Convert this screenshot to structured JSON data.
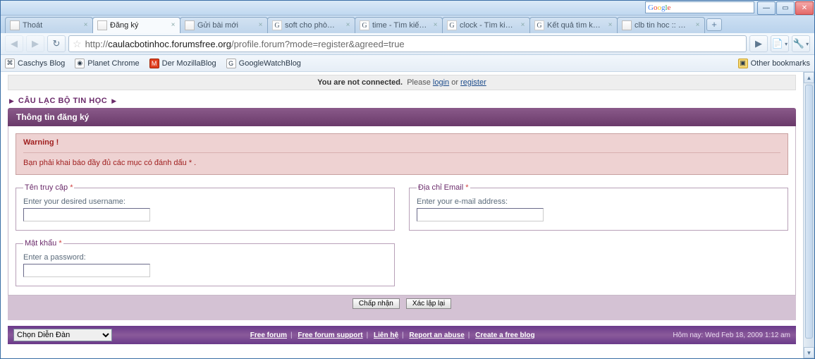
{
  "window": {
    "search_placeholder": "Google"
  },
  "tabs": [
    {
      "label": "Thoát"
    },
    {
      "label": "Đăng ký"
    },
    {
      "label": "Gửi bài mới"
    },
    {
      "label": "soft cho phò…"
    },
    {
      "label": "time - Tìm kiế…"
    },
    {
      "label": "clock - Tìm ki…"
    },
    {
      "label": "Kết quả tìm k…"
    },
    {
      "label": "clb tin hoc :: …"
    }
  ],
  "nav": {
    "url_prefix": "http://",
    "url_domain": "caulacbotinhoc.forumsfree.org",
    "url_path": "/profile.forum?mode=register&agreed=true"
  },
  "bookmarks": [
    {
      "label": "Caschys Blog"
    },
    {
      "label": "Planet Chrome"
    },
    {
      "label": "Der MozillaBlog"
    },
    {
      "label": "GoogleWatchBlog"
    }
  ],
  "other_bookmarks": "Other bookmarks",
  "notice": {
    "bold": "You are not connected.",
    "text1": "Please ",
    "login": "login",
    "or": " or ",
    "register": "register"
  },
  "breadcrumb": {
    "home": "CÂU LẠC BỘ TIN HỌC"
  },
  "section_title": "Thông tin đăng ký",
  "warning": {
    "title": "Warning !",
    "message": "Bạn phải khai báo đầy đủ các mục có đánh dấu * ."
  },
  "fields": {
    "username": {
      "legend": "Tên truy cập",
      "hint": "Enter your desired username:"
    },
    "email": {
      "legend": "Địa chỉ Email",
      "hint": "Enter your e-mail address:"
    },
    "password": {
      "legend": "Mật khẩu",
      "hint": "Enter a password:"
    },
    "req": "*"
  },
  "buttons": {
    "submit": "Chấp nhận",
    "reset": "Xác lập lại"
  },
  "footer": {
    "select_placeholder": "Chọn Diễn Ðàn",
    "links": [
      "Free forum",
      "Free forum support",
      "Liên hệ",
      "Report an abuse",
      "Create a free blog"
    ],
    "date": "Hôm nay: Wed Feb 18, 2009 1:12 am"
  }
}
